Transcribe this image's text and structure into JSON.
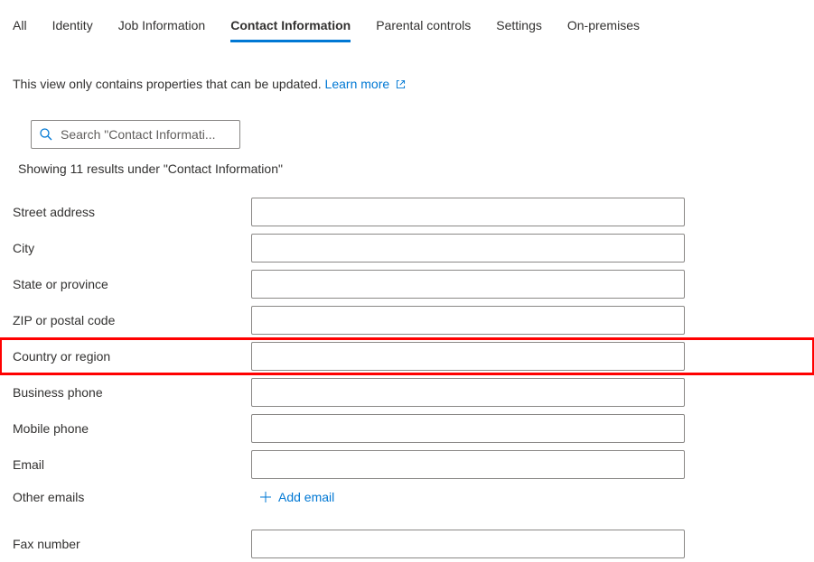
{
  "tabs": [
    {
      "label": "All",
      "active": false
    },
    {
      "label": "Identity",
      "active": false
    },
    {
      "label": "Job Information",
      "active": false
    },
    {
      "label": "Contact Information",
      "active": true
    },
    {
      "label": "Parental controls",
      "active": false
    },
    {
      "label": "Settings",
      "active": false
    },
    {
      "label": "On-premises",
      "active": false
    }
  ],
  "info_text": "This view only contains properties that can be updated.",
  "learn_more": "Learn more",
  "search_placeholder": "Search \"Contact Informati...",
  "results_text": "Showing 11 results under \"Contact Information\"",
  "fields": [
    {
      "label": "Street address",
      "value": "",
      "highlighted": false,
      "type": "input"
    },
    {
      "label": "City",
      "value": "",
      "highlighted": false,
      "type": "input"
    },
    {
      "label": "State or province",
      "value": "",
      "highlighted": false,
      "type": "input"
    },
    {
      "label": "ZIP or postal code",
      "value": "",
      "highlighted": false,
      "type": "input"
    },
    {
      "label": "Country or region",
      "value": "",
      "highlighted": true,
      "type": "input"
    },
    {
      "label": "Business phone",
      "value": "",
      "highlighted": false,
      "type": "input"
    },
    {
      "label": "Mobile phone",
      "value": "",
      "highlighted": false,
      "type": "input"
    },
    {
      "label": "Email",
      "value": "",
      "highlighted": false,
      "type": "input"
    },
    {
      "label": "Other emails",
      "value": "",
      "highlighted": false,
      "type": "add"
    },
    {
      "label": "Fax number",
      "value": "",
      "highlighted": false,
      "type": "input"
    }
  ],
  "add_email_label": "Add email"
}
